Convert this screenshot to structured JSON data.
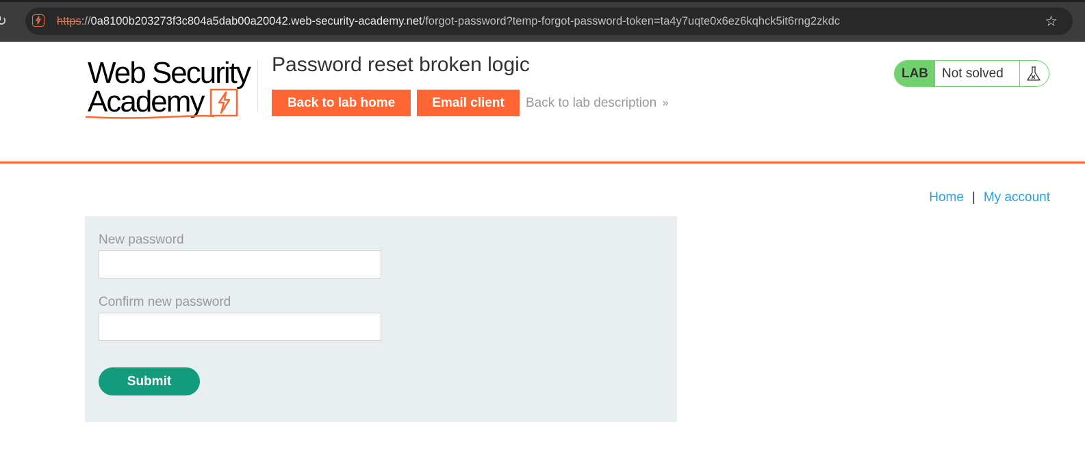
{
  "browser": {
    "url_scheme": "https",
    "url_separator": "://",
    "url_host": "0a8100b203273f3c804a5dab00a20042.web-security-academy.net",
    "url_path": "/forgot-password?temp-forgot-password-token=ta4y7uqte0x6ez6kqhck5it6rng2zkdc",
    "icons": {
      "reload": "reload-icon",
      "site": "site-info-icon",
      "bookmark": "star-icon"
    }
  },
  "header": {
    "logo_line1": "Web Security",
    "logo_line2": "Academy",
    "lab_title": "Password reset broken logic",
    "back_to_lab_home": "Back to lab home",
    "email_client": "Email client",
    "back_to_description": "Back to lab description",
    "back_chevron": "»",
    "lab_badge": "LAB",
    "lab_status": "Not solved",
    "status_icon": "flask-icon"
  },
  "nav": {
    "home": "Home",
    "separator": "|",
    "my_account": "My account"
  },
  "form": {
    "new_password_label": "New password",
    "new_password_value": "",
    "confirm_password_label": "Confirm new password",
    "confirm_password_value": "",
    "submit_label": "Submit"
  },
  "colors": {
    "brand_orange": "#ff6633",
    "status_green": "#70d16d",
    "submit_green": "#139b7e",
    "link_blue": "#29a1e1",
    "panel_bg": "#e9eef1"
  }
}
